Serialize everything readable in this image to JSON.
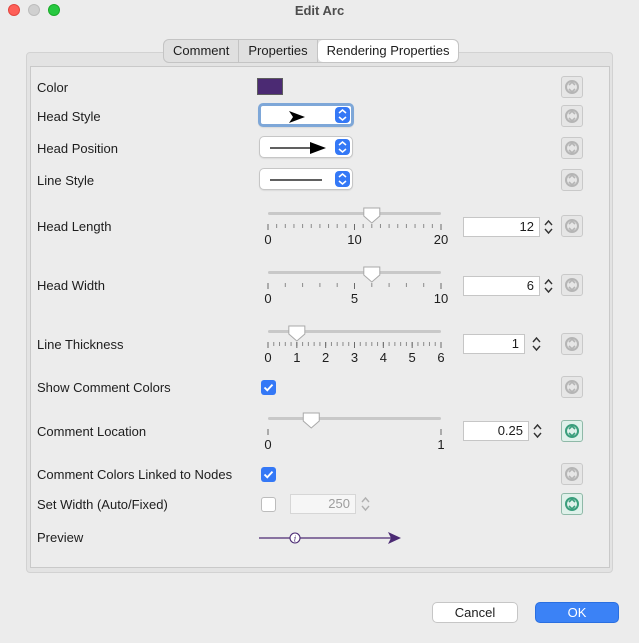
{
  "window": {
    "title": "Edit Arc"
  },
  "tabs": [
    {
      "label": "Comment",
      "active": false
    },
    {
      "label": "Properties",
      "active": false
    },
    {
      "label": "Rendering Properties",
      "active": true
    }
  ],
  "rows": {
    "color": {
      "label": "Color",
      "value": "#4b2a73"
    },
    "head_style": {
      "label": "Head Style",
      "icon": "arrowhead-icon"
    },
    "head_position": {
      "label": "Head Position",
      "icon": "arrow-end-icon"
    },
    "line_style": {
      "label": "Line Style",
      "icon": "solid-line-icon"
    },
    "head_length": {
      "label": "Head Length",
      "value": "12",
      "min": 0,
      "max": 20,
      "ticks": [
        "0",
        "10",
        "20"
      ],
      "level": 12
    },
    "head_width": {
      "label": "Head Width",
      "value": "6",
      "min": 0,
      "max": 10,
      "ticks": [
        "0",
        "5",
        "10"
      ],
      "level": 6
    },
    "line_thickness": {
      "label": "Line Thickness",
      "value": "1",
      "min": 0,
      "max": 6,
      "ticks": [
        "0",
        "1",
        "2",
        "3",
        "4",
        "5",
        "6"
      ],
      "level": 1
    },
    "show_comment_colors": {
      "label": "Show Comment Colors",
      "checked": true
    },
    "comment_location": {
      "label": "Comment Location",
      "value": "0.25",
      "min": 0,
      "max": 1,
      "ticks": [
        "0",
        "1"
      ],
      "level": 0.25
    },
    "comment_colors_linked": {
      "label": "Comment Colors Linked to Nodes",
      "checked": true
    },
    "set_width": {
      "label": "Set Width (Auto/Fixed)",
      "checked": false,
      "value": "250"
    },
    "preview": {
      "label": "Preview",
      "info_glyph": "i"
    }
  },
  "buttons": {
    "cancel": "Cancel",
    "ok": "OK"
  },
  "colors": {
    "accent": "#3478f6",
    "arc": "#4b2a73",
    "reset_active": "#3a9e7c"
  }
}
